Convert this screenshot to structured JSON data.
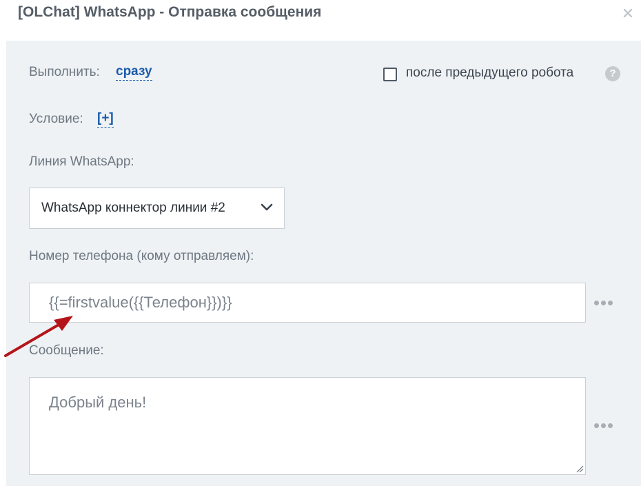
{
  "window": {
    "title": "[OLChat] WhatsApp - Отправка сообщения",
    "close_icon": "close-icon"
  },
  "execute": {
    "label": "Выполнить:",
    "value": "сразу",
    "after_previous_label": "после предыдущего робота",
    "after_previous_checked": false,
    "help_icon": "question-icon",
    "help_glyph": "?"
  },
  "condition": {
    "label": "Условие:",
    "add_link": "[+]"
  },
  "line": {
    "label": "Линия WhatsApp:",
    "selected": "WhatsApp коннектор линии #2",
    "chevron_icon": "chevron-down-icon"
  },
  "phone": {
    "label": "Номер телефона (кому отправляем):",
    "value": "{{=firstvalue({{Телефон}})}}",
    "more_icon": "more-dots-icon"
  },
  "message": {
    "label": "Сообщение:",
    "value": "Добрый день!",
    "more_icon": "more-dots-icon"
  },
  "colors": {
    "panel_bg": "#eef2f4",
    "link": "#1c5bab",
    "arrow": "#b3151b"
  }
}
